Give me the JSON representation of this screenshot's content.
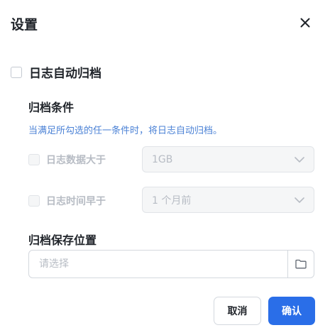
{
  "dialog": {
    "title": "设置",
    "close_icon": "close-icon"
  },
  "auto_archive": {
    "label": "日志自动归档",
    "checked": false
  },
  "conditions": {
    "title": "归档条件",
    "hint": "当满足所勾选的任一条件时，将日志自动归档。",
    "size_rule": {
      "label": "日志数据大于",
      "value": "1GB",
      "checked": false,
      "disabled": true
    },
    "time_rule": {
      "label": "日志时间早于",
      "value": "1 个月前",
      "checked": false,
      "disabled": true
    }
  },
  "location": {
    "title": "归档保存位置",
    "placeholder": "请选择",
    "value": "",
    "browse_icon": "folder-icon"
  },
  "footer": {
    "cancel_label": "取消",
    "confirm_label": "确认"
  },
  "colors": {
    "primary": "#2a6ee8",
    "hint": "#4b82d6",
    "disabled_text": "#b7bcc4",
    "text": "#1f2329"
  }
}
